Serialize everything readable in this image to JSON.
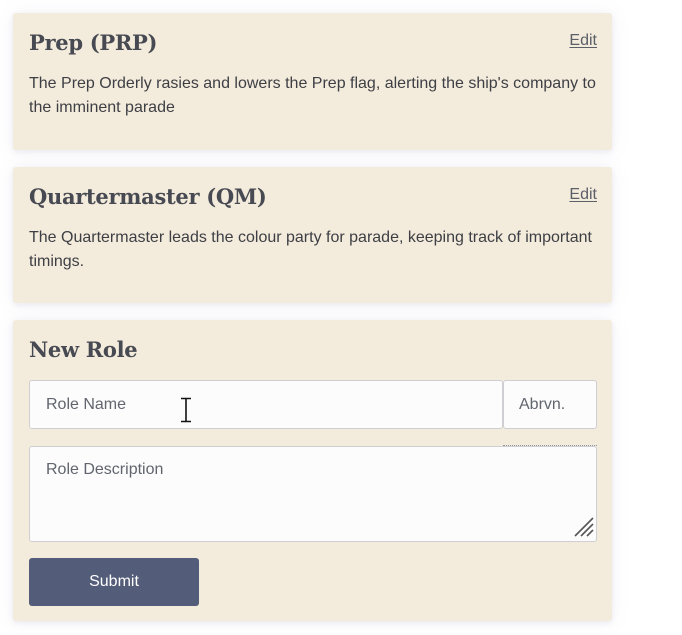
{
  "roles": [
    {
      "title": "Prep (PRP)",
      "edit_label": "Edit",
      "description": "The Prep Orderly rasies and lowers the Prep flag, alerting the ship's company to the imminent parade"
    },
    {
      "title": "Quartermaster (QM)",
      "edit_label": "Edit",
      "description": "The Quartermaster leads the colour party for parade, keeping track of important timings."
    }
  ],
  "new_role": {
    "title": "New Role",
    "name_placeholder": "Role Name",
    "abbr_placeholder": "Abrvn.",
    "description_placeholder": "Role Description",
    "submit_label": "Submit"
  },
  "colors": {
    "card_background": "#f3ebdb",
    "heading_text": "#474a52",
    "button_background": "#535c78"
  },
  "icons": {
    "text_cursor": "i-beam-cursor-icon",
    "resize_handle": "resize-grip-icon"
  }
}
